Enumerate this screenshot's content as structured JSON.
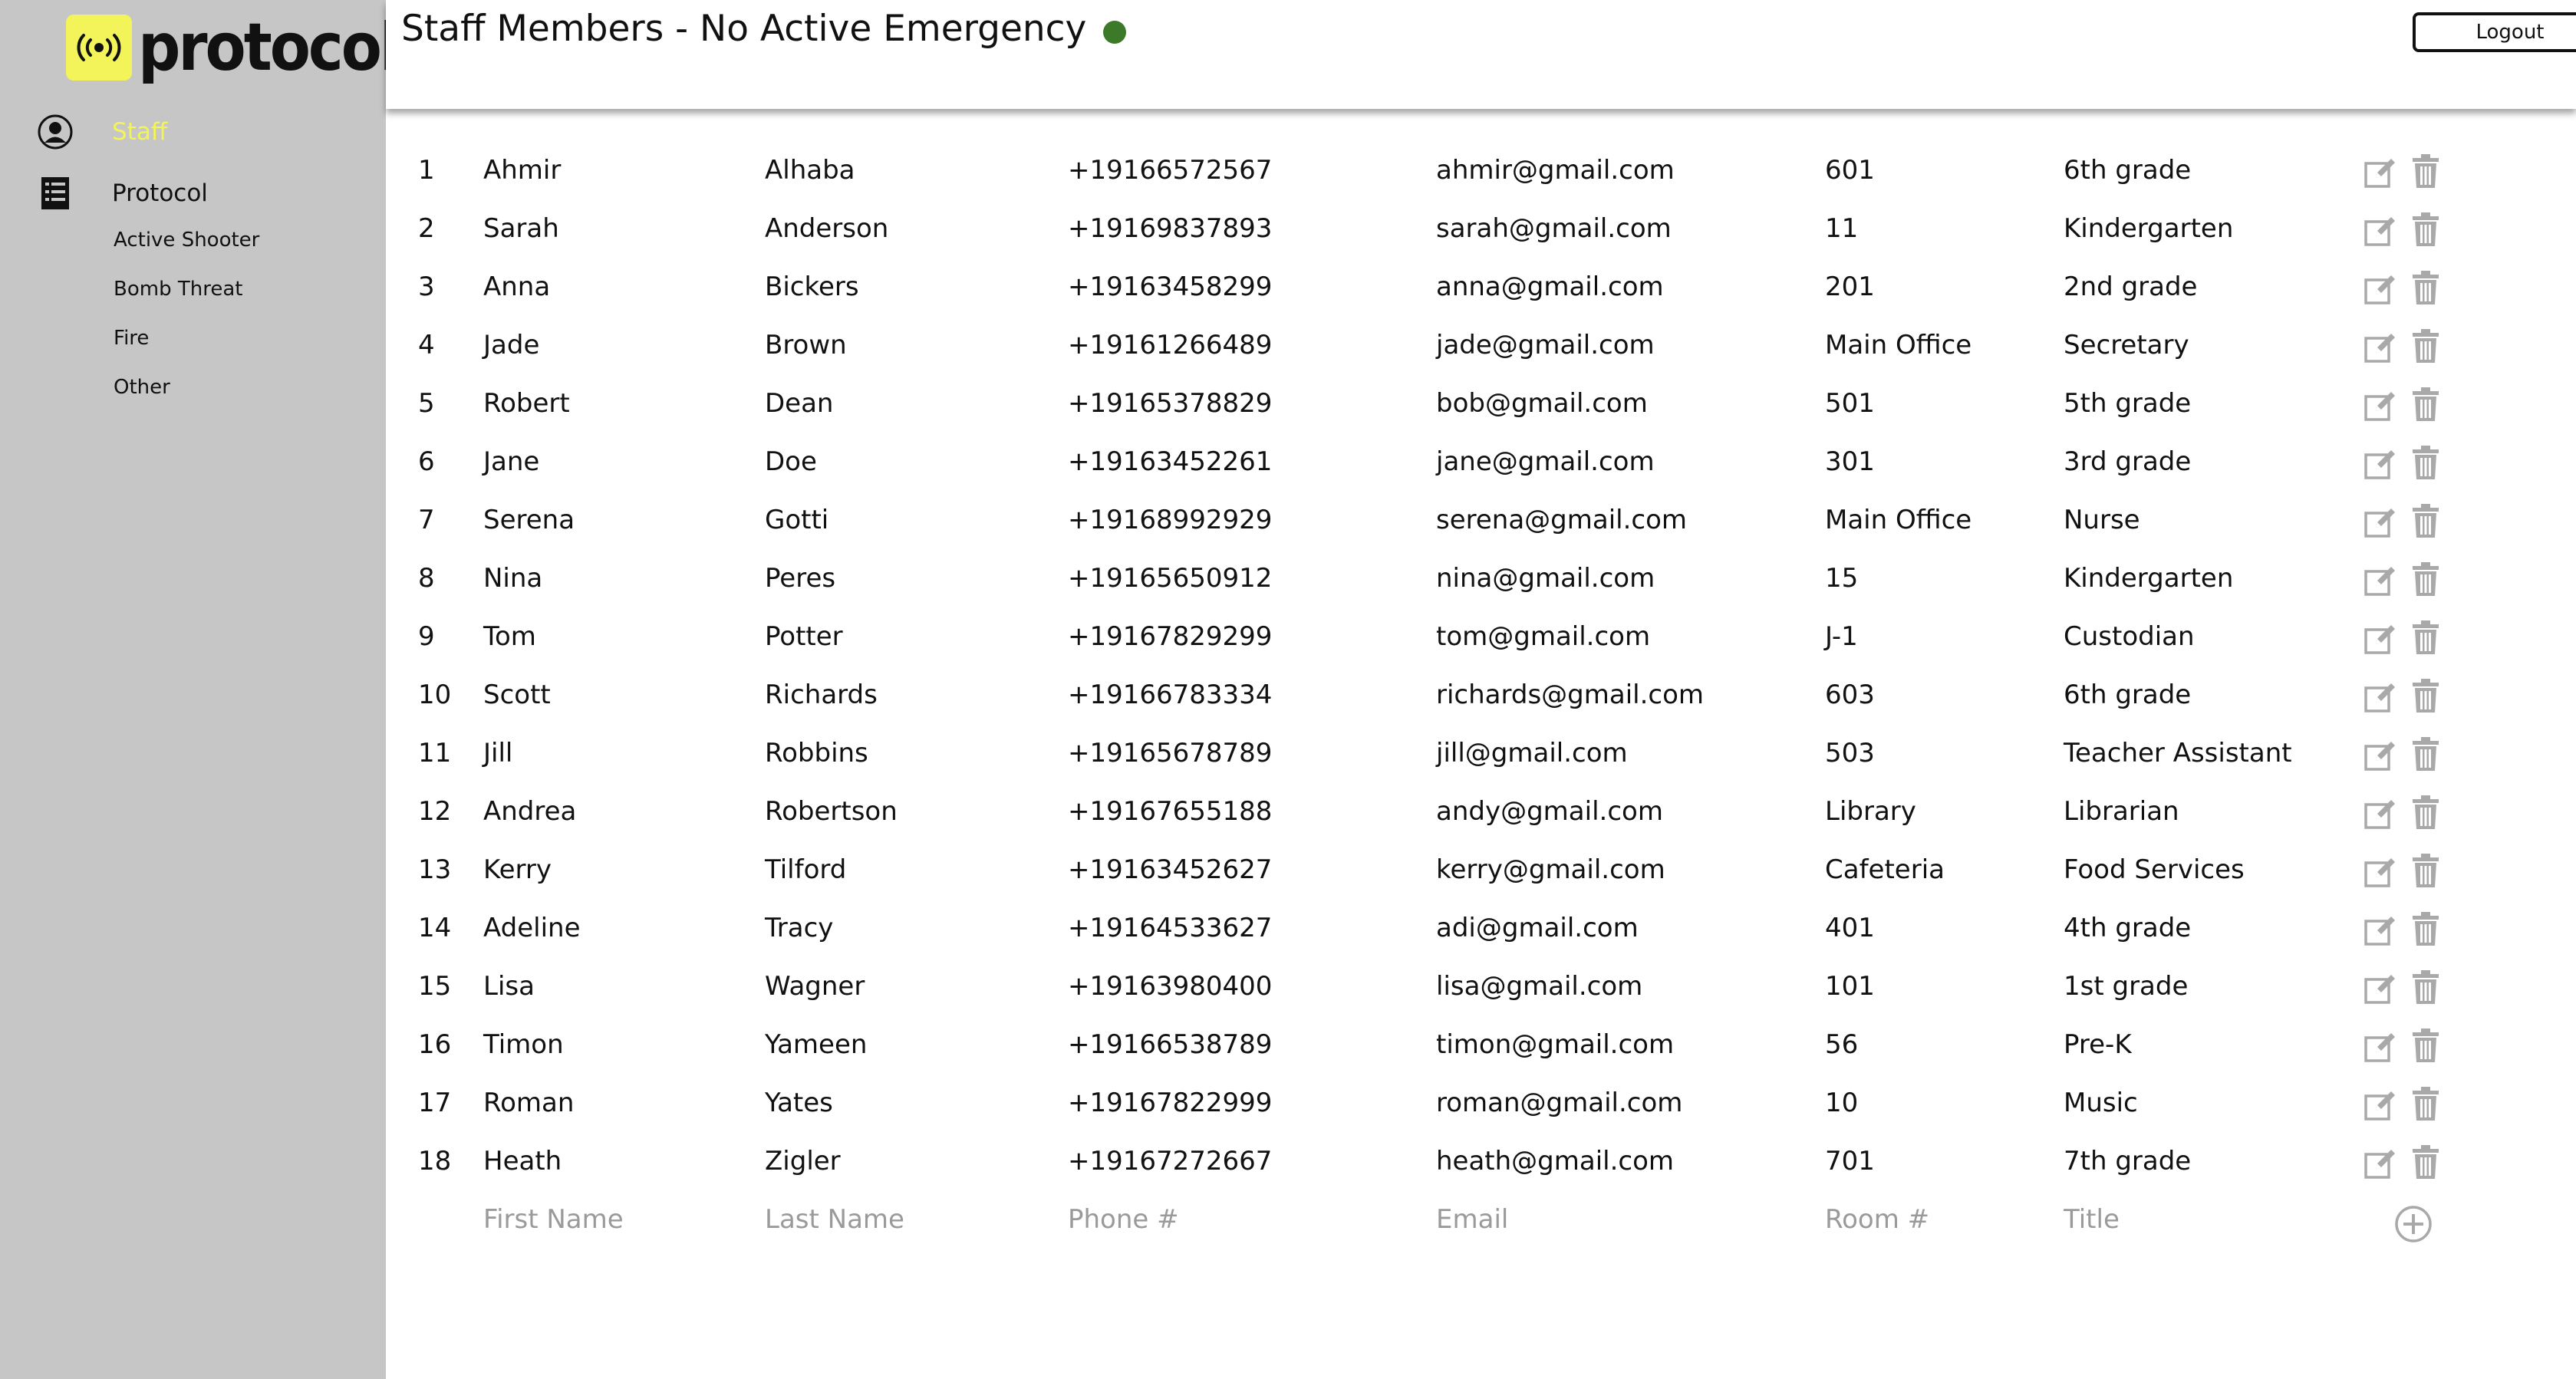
{
  "app": {
    "logo_text": "protocol"
  },
  "sidebar": {
    "staff_label": "Staff",
    "protocol_label": "Protocol",
    "protocol_items": [
      "Active Shooter",
      "Bomb Threat",
      "Fire",
      "Other"
    ]
  },
  "header": {
    "title": "Staff Members - No Active Emergency",
    "status_color": "#3c7a2a",
    "logout_label": "Logout"
  },
  "staff": [
    {
      "num": "1",
      "first": "Ahmir",
      "last": "Alhaba",
      "phone": "+19166572567",
      "email": "ahmir@gmail.com",
      "room": "601",
      "title": "6th grade"
    },
    {
      "num": "2",
      "first": "Sarah",
      "last": "Anderson",
      "phone": "+19169837893",
      "email": "sarah@gmail.com",
      "room": "11",
      "title": "Kindergarten"
    },
    {
      "num": "3",
      "first": "Anna",
      "last": "Bickers",
      "phone": "+19163458299",
      "email": "anna@gmail.com",
      "room": "201",
      "title": "2nd grade"
    },
    {
      "num": "4",
      "first": "Jade",
      "last": "Brown",
      "phone": "+19161266489",
      "email": "jade@gmail.com",
      "room": "Main Office",
      "title": "Secretary"
    },
    {
      "num": "5",
      "first": "Robert",
      "last": "Dean",
      "phone": "+19165378829",
      "email": "bob@gmail.com",
      "room": "501",
      "title": "5th grade"
    },
    {
      "num": "6",
      "first": "Jane",
      "last": "Doe",
      "phone": "+19163452261",
      "email": "jane@gmail.com",
      "room": "301",
      "title": "3rd grade"
    },
    {
      "num": "7",
      "first": "Serena",
      "last": "Gotti",
      "phone": "+19168992929",
      "email": "serena@gmail.com",
      "room": "Main Office",
      "title": "Nurse"
    },
    {
      "num": "8",
      "first": "Nina",
      "last": "Peres",
      "phone": "+19165650912",
      "email": "nina@gmail.com",
      "room": "15",
      "title": "Kindergarten"
    },
    {
      "num": "9",
      "first": "Tom",
      "last": "Potter",
      "phone": "+19167829299",
      "email": "tom@gmail.com",
      "room": "J-1",
      "title": "Custodian"
    },
    {
      "num": "10",
      "first": "Scott",
      "last": "Richards",
      "phone": "+19166783334",
      "email": "richards@gmail.com",
      "room": "603",
      "title": "6th grade"
    },
    {
      "num": "11",
      "first": "Jill",
      "last": "Robbins",
      "phone": "+19165678789",
      "email": "jill@gmail.com",
      "room": "503",
      "title": "Teacher Assistant"
    },
    {
      "num": "12",
      "first": "Andrea",
      "last": "Robertson",
      "phone": "+19167655188",
      "email": "andy@gmail.com",
      "room": "Library",
      "title": "Librarian"
    },
    {
      "num": "13",
      "first": "Kerry",
      "last": "Tilford",
      "phone": "+19163452627",
      "email": "kerry@gmail.com",
      "room": "Cafeteria",
      "title": "Food Services"
    },
    {
      "num": "14",
      "first": "Adeline",
      "last": "Tracy",
      "phone": "+19164533627",
      "email": "adi@gmail.com",
      "room": "401",
      "title": "4th grade"
    },
    {
      "num": "15",
      "first": "Lisa",
      "last": "Wagner",
      "phone": "+19163980400",
      "email": "lisa@gmail.com",
      "room": "101",
      "title": "1st grade"
    },
    {
      "num": "16",
      "first": "Timon",
      "last": "Yameen",
      "phone": "+19166538789",
      "email": "timon@gmail.com",
      "room": "56",
      "title": "Pre-K"
    },
    {
      "num": "17",
      "first": "Roman",
      "last": "Yates",
      "phone": "+19167822999",
      "email": "roman@gmail.com",
      "room": "10",
      "title": "Music"
    },
    {
      "num": "18",
      "first": "Heath",
      "last": "Zigler",
      "phone": "+19167272667",
      "email": "heath@gmail.com",
      "room": "701",
      "title": "7th grade"
    }
  ],
  "new_row": {
    "first_placeholder": "First Name",
    "last_placeholder": "Last Name",
    "phone_placeholder": "Phone #",
    "email_placeholder": "Email",
    "room_placeholder": "Room #",
    "title_placeholder": "Title"
  },
  "icons": {
    "edit": "edit-icon",
    "delete": "trash-icon",
    "add": "plus-circle-icon",
    "staff": "user-circle-icon",
    "protocol": "checklist-icon",
    "logo": "broadcast-icon"
  }
}
